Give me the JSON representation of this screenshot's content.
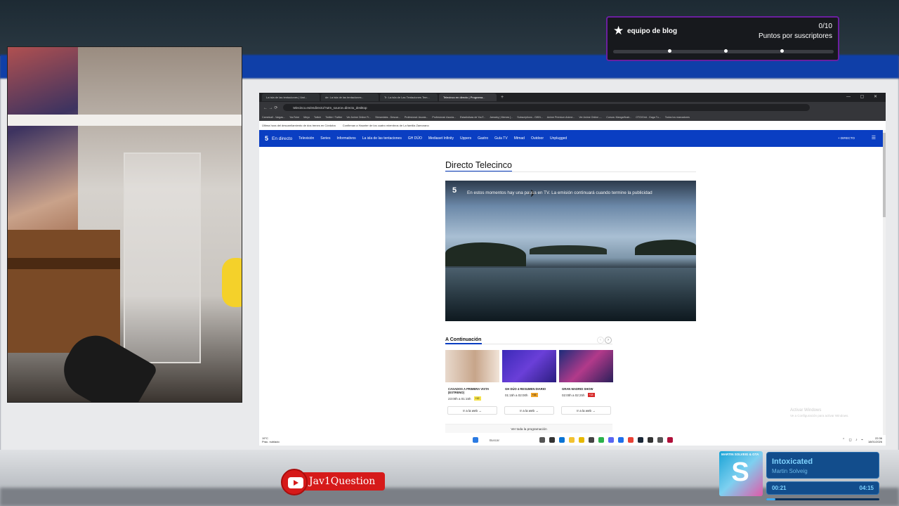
{
  "overlay_notification": {
    "icon": "star-badge-icon",
    "title": "equipo de blog",
    "count": "0/10",
    "subtitle": "Puntos por suscriptores"
  },
  "browser": {
    "tabs": [
      {
        "label": "La isla de las tentaciones | Vari...",
        "active": false
      },
      {
        "label": "de: La isla de las tentaciones -",
        "active": false
      },
      {
        "label": "Tr: La isla de Las Tentaciones Tem...",
        "active": false
      },
      {
        "label": "Telecinco en directo | Programa...",
        "active": true
      }
    ],
    "url": "telecinco.es/endirecto/?utm_source=directo_desktop",
    "bookmarks": [
      "Camelcall - Vargas...",
      "YouTube",
      "Meyo",
      "Twitch",
      "Twitter / Twitter",
      "Ver Anime Online Fr...",
      "Streamlabs - Descar...",
      "Profesional: Asocia...",
      "Profesional: Asocia...",
      "Estadísticas de YouT...",
      "Jamaley | Memes [...",
      "Subscriptions - OWN...",
      "Anime Premium Anime...",
      "Ver Anime Online -...",
      "Cursos: Manga/Ilustr...",
      "OTG/Grid - Gaga Tu...",
      "Todos los marcadores"
    ],
    "notices": [
      "Última hora del descarrilamiento de dos trenes en Córdoba",
      "Confirman a Haunter de los cuatro miembros de La familia Zamorano"
    ]
  },
  "site": {
    "nav": [
      "En directo",
      "Televisión",
      "Series",
      "Informativos",
      "La isla de las tentaciones",
      "GH DÚO",
      "Mediaset Infinity",
      "Uppers",
      "Gastro",
      "Guía TV",
      "Mtmad",
      "Outdoor",
      "Unplugged"
    ],
    "nav_right": "+ DIRECTO",
    "heading": "Directo Telecinco",
    "video_message": "En estos momentos hay una pausa en TV. La emisión continuará cuando termine la publicidad",
    "next_heading": "A Continuación",
    "cards": [
      {
        "title": "CASADOS A PRIMERA VISTA (ESTRENO)",
        "time": "23:00h a 01:15h",
        "rating": "+12",
        "rating_color": "#f5e24a",
        "button": "Ir a la web →"
      },
      {
        "title": "GH DÚO 4 RESUMEN DIARIO",
        "time": "01:15h a 02:00h",
        "rating": "+16",
        "rating_color": "#f0a52a",
        "button": "Ir a la web →"
      },
      {
        "title": "GRAN MADRID SHOW",
        "time": "02:00h a 02:25h",
        "rating": "+18",
        "rating_color": "#d72828",
        "button": "Ir a la web →"
      }
    ],
    "all_programming": "Ver toda la programación",
    "activate_windows": [
      "Activar Windows",
      "Ve a Configuración para activar Windows."
    ]
  },
  "taskbar": {
    "weather": [
      "19°C",
      "Prac. nublado"
    ],
    "search_placeholder": "Buscar",
    "clock": [
      "22:36",
      "18/01/2026"
    ]
  },
  "youtube_badge": {
    "handle": "Jav1Question"
  },
  "music_widget": {
    "album_top": "MARTIN SOLVEIG & GTA",
    "song": "Intoxicated",
    "artist": "Martin Solveig",
    "current_time": "00:21",
    "total_time": "04:15",
    "progress_fraction": 0.08,
    "accent": "#7fd3ff"
  },
  "colors": {
    "telecinco_blue": "#0a3ec2",
    "stream_purple": "#6b1fa0",
    "youtube_red": "#d61a1a"
  }
}
